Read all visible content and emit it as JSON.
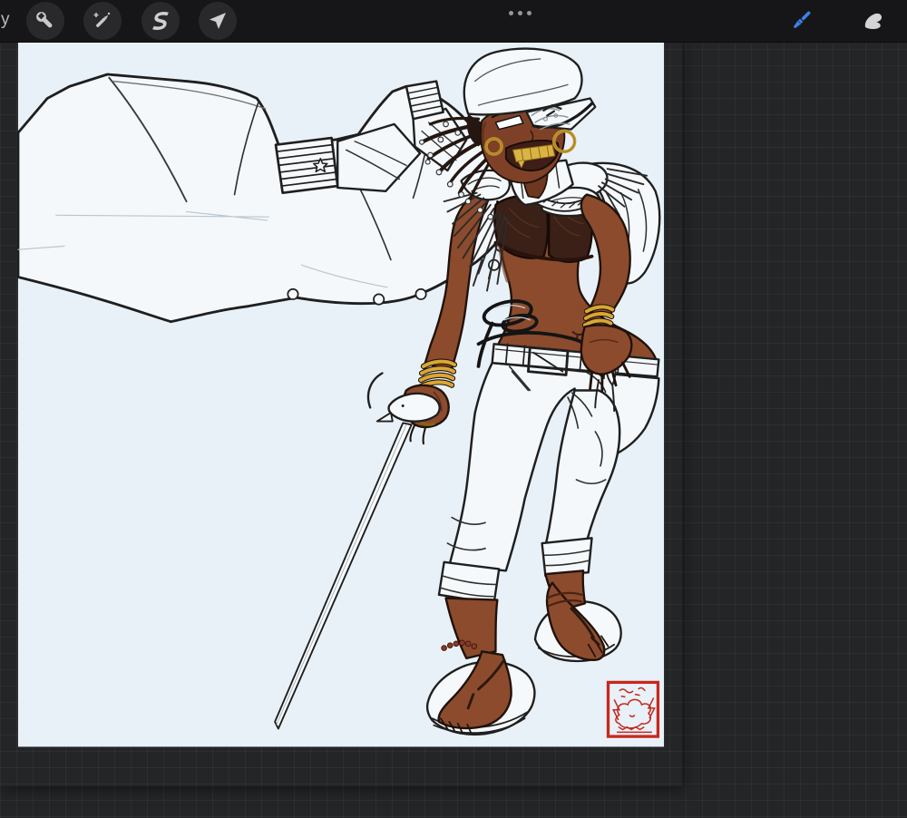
{
  "toolbar": {
    "gallery_label_partial": "y",
    "left_tools": [
      "actions",
      "adjustments",
      "selection",
      "transform"
    ],
    "more_indicator": "ellipsis",
    "right_tools": [
      "paint-brush",
      "smudge"
    ],
    "active_tool": "paint-brush"
  },
  "colors": {
    "toolbar_bg": "#161618",
    "workspace_bg": "#232527",
    "canvas_bg": "#e9f1f8",
    "line_ink": "#1f1f1f",
    "icon_gray": "#c9c9c9",
    "accent_blue": "#3a82e8",
    "skin": "#8c4b2d",
    "skin_shadow": "#6d3720",
    "bikini_brown": "#3a2016",
    "gold": "#d9a733",
    "teeth_gold": "#d9b445",
    "stamp_red": "#c6281e"
  },
  "canvas": {
    "artwork_subject": "Pirate captain woman in white naval cape-coat and captain hat, gold hoops and bangles, white capri pants, platform sandals, holding a rapier",
    "artist_stamp": "red square seal at bottom right"
  }
}
